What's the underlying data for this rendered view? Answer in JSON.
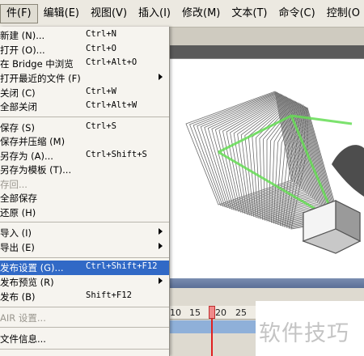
{
  "menubar": {
    "items": [
      {
        "label": "件(F)",
        "active": true
      },
      {
        "label": "编辑(E)"
      },
      {
        "label": "视图(V)"
      },
      {
        "label": "插入(I)"
      },
      {
        "label": "修改(M)"
      },
      {
        "label": "文本(T)"
      },
      {
        "label": "命令(C)"
      },
      {
        "label": "控制(O"
      }
    ]
  },
  "file_menu": {
    "items": [
      {
        "label": "新建 (N)...",
        "shortcut": "Ctrl+N"
      },
      {
        "label": "打开 (O)...",
        "shortcut": "Ctrl+O"
      },
      {
        "label": "在 Bridge 中浏览",
        "shortcut": "Ctrl+Alt+O"
      },
      {
        "label": "打开最近的文件 (F)",
        "submenu": true
      },
      {
        "label": "关闭 (C)",
        "shortcut": "Ctrl+W"
      },
      {
        "label": "全部关闭",
        "shortcut": "Ctrl+Alt+W"
      },
      {
        "label": "保存 (S)",
        "shortcut": "Ctrl+S"
      },
      {
        "label": "保存并压缩 (M)"
      },
      {
        "label": "另存为 (A)...",
        "shortcut": "Ctrl+Shift+S"
      },
      {
        "label": "另存为模板 (T)..."
      },
      {
        "label": "存回...",
        "disabled": true
      },
      {
        "label": "全部保存"
      },
      {
        "label": "还原 (H)"
      },
      {
        "label": "导入 (I)",
        "submenu": true
      },
      {
        "label": "导出 (E)",
        "submenu": true
      },
      {
        "label": "发布设置 (G)...",
        "shortcut": "Ctrl+Shift+F12",
        "highlighted": true
      },
      {
        "label": "发布预览 (R)",
        "submenu": true
      },
      {
        "label": "发布 (B)",
        "shortcut": "Shift+F12"
      },
      {
        "label": "AIR 设置...",
        "disabled": true
      },
      {
        "label": "文件信息..."
      }
    ]
  },
  "timeline": {
    "ticks": [
      "10",
      "15",
      "20",
      "25"
    ]
  },
  "watermark": "软件技巧",
  "colors": {
    "menu_highlight": "#3169c6",
    "playhead": "#e02020",
    "frames": "#8fb0d9"
  }
}
